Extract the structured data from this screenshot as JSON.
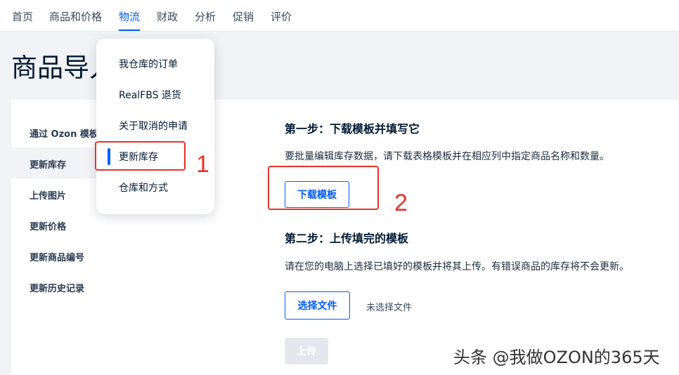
{
  "topnav": {
    "items": [
      "首页",
      "商品和价格",
      "物流",
      "财政",
      "分析",
      "促销",
      "评价"
    ],
    "active": "物流"
  },
  "page": {
    "title": "商品导入"
  },
  "sidebar": {
    "items": [
      "通过 Ozon 模板",
      "更新库存",
      "上传图片",
      "更新价格",
      "更新商品编号",
      "更新历史记录"
    ],
    "active": "更新库存"
  },
  "step1": {
    "title": "第一步：下载模板并填写它",
    "text": "要批量编辑库存数据，请下载表格模板并在相应列中指定商品名称和数量。",
    "button": "下载模板"
  },
  "step2": {
    "title": "第二步：上传填完的模板",
    "text": "请在您的电脑上选择已填好的模板并将其上传。有错误商品的库存将不会更新。",
    "choose_button": "选择文件",
    "file_status": "未选择文件",
    "upload_button": "上传"
  },
  "dropdown": {
    "items": [
      "我仓库的订单",
      "RealFBS 退货",
      "关于取消的申请",
      "更新库存",
      "仓库和方式"
    ],
    "active": "更新库存"
  },
  "annotations": {
    "label_1": "1",
    "label_2": "2"
  },
  "watermark": "头条 @我做OZON的365天",
  "colors": {
    "accent": "#005bff",
    "annotation": "#e8322c",
    "background": "#f1f3f6"
  }
}
